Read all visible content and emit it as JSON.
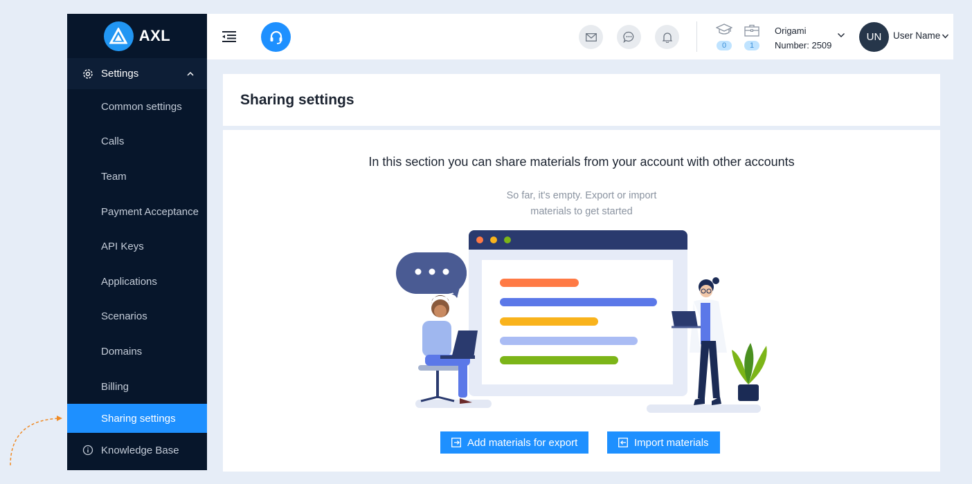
{
  "brand": {
    "name": "AXL"
  },
  "sidebar": {
    "group": {
      "label": "Settings",
      "icon": "gear-icon"
    },
    "items": [
      {
        "label": "Common settings"
      },
      {
        "label": "Calls"
      },
      {
        "label": "Team"
      },
      {
        "label": "Payment Acceptance"
      },
      {
        "label": "API Keys"
      },
      {
        "label": "Applications"
      },
      {
        "label": "Scenarios"
      },
      {
        "label": "Domains"
      },
      {
        "label": "Billing"
      },
      {
        "label": "Sharing settings",
        "active": true
      }
    ],
    "knowledge_base": {
      "label": "Knowledge Base",
      "icon": "info-icon"
    }
  },
  "header": {
    "stats": [
      {
        "icon": "graduation-cap-icon",
        "count": "0"
      },
      {
        "icon": "briefcase-icon",
        "count": "1"
      }
    ],
    "account": {
      "name": "Origami",
      "number": "Number: 2509"
    },
    "user": {
      "initials": "UN",
      "name": "User Name"
    }
  },
  "page": {
    "title": "Sharing settings",
    "intro": "In this section you can share materials from your account with other accounts",
    "empty_line1": "So far, it's empty. Export or import",
    "empty_line2": "materials to get started",
    "buttons": {
      "export": "Add materials for export",
      "import": "Import materials"
    }
  },
  "colors": {
    "sidebar_bg": "#07162b",
    "accent": "#1e90ff",
    "page_bg": "#e6edf7"
  }
}
